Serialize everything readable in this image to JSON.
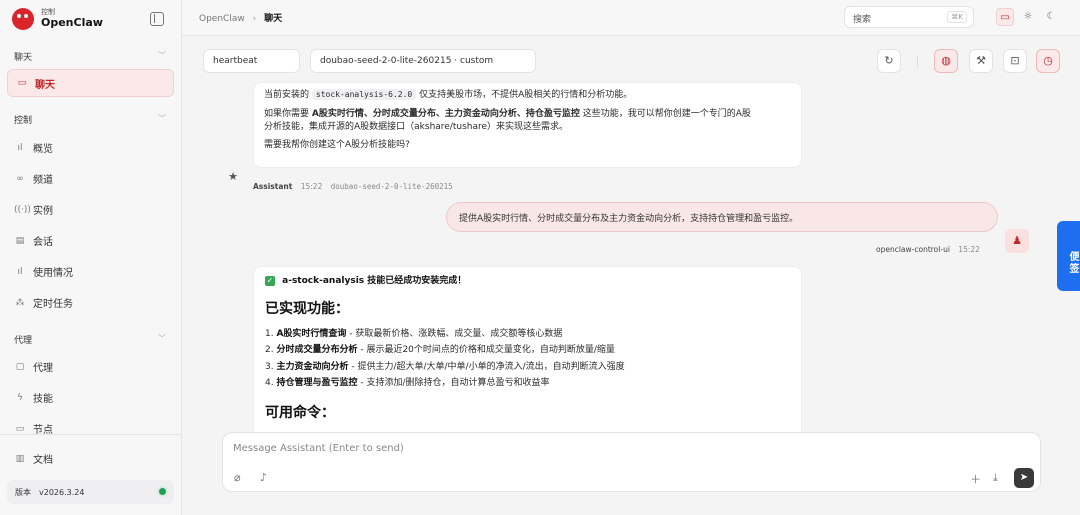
{
  "brand": {
    "sub": "控制",
    "name": "OpenClaw"
  },
  "sidebar": {
    "sections": {
      "chat": "聊天",
      "control": "控制",
      "agent": "代理"
    },
    "active_item": "聊天",
    "items": [
      {
        "label": "概览",
        "icon": "chart-icon"
      },
      {
        "label": "频道",
        "icon": "link-icon"
      },
      {
        "label": "实例",
        "icon": "broadcast-icon"
      },
      {
        "label": "会话",
        "icon": "document-icon"
      },
      {
        "label": "使用情况",
        "icon": "bar-chart-icon"
      },
      {
        "label": "定时任务",
        "icon": "loader-icon"
      },
      {
        "label": "代理",
        "icon": "folder-icon"
      },
      {
        "label": "技能",
        "icon": "bolt-icon"
      },
      {
        "label": "节点",
        "icon": "monitor-icon"
      }
    ],
    "docs": "文档",
    "version_label": "版本",
    "version_value": "v2026.3.24"
  },
  "topbar": {
    "breadcrumb_root": "OpenClaw",
    "breadcrumb_current": "聊天",
    "search_placeholder": "搜索",
    "search_shortcut": "⌘K"
  },
  "chat_header": {
    "session": "heartbeat",
    "model": "doubao-seed-2-0-lite-260215 · custom"
  },
  "messages": {
    "first": {
      "line1_pre": "当前安装的",
      "line1_code": "stock-analysis-6.2.0",
      "line1_post": "仅支持美股市场，不提供A股相关的行情和分析功能。",
      "line2_pre": "如果你需要",
      "line2_bold": "A股实时行情、分时成交量分布、主力资金动向分析、持仓盈亏监控",
      "line2_post": "这些功能，我可以帮你创建一个专门的A股",
      "line3": "分析技能，集成开源的A股数据接口（akshare/tushare）来实现这些需求。",
      "line4": "需要我帮你创建这个A股分析技能吗?"
    },
    "assistant_meta": {
      "name": "Assistant",
      "time": "15:22",
      "model": "doubao-seed-2-0-lite-260215"
    },
    "user": {
      "text": "提供A股实时行情、分时成交量分布及主力资金动向分析，支持持仓管理和盈亏监控。",
      "name": "openclaw-control-ui",
      "time": "15:22"
    },
    "second": {
      "title": "a-stock-analysis 技能已经成功安装完成！",
      "h_features": "已实现功能：",
      "features": [
        {
          "bold": "A股实时行情查询",
          "text": " - 获取最新价格、涨跌幅、成交量、成交额等核心数据"
        },
        {
          "bold": "分时成交量分布分析",
          "text": " - 展示最近20个时间点的价格和成交量变化，自动判断放量/缩量"
        },
        {
          "bold": "主力资金动向分析",
          "text": " - 提供主力/超大单/大单/中单/小单的净流入/流出，自动判断流入强度"
        },
        {
          "bold": "持仓管理与盈亏监控",
          "text": " - 支持添加/删除持仓，自动计算总盈亏和收益率"
        }
      ],
      "h_commands": "可用命令："
    }
  },
  "side_tab": "便签",
  "composer": {
    "placeholder": "Message Assistant (Enter to send)"
  },
  "colors": {
    "accent": "#c02828",
    "side_tab": "#1e6ff0",
    "status_ok": "#1f9d55"
  }
}
